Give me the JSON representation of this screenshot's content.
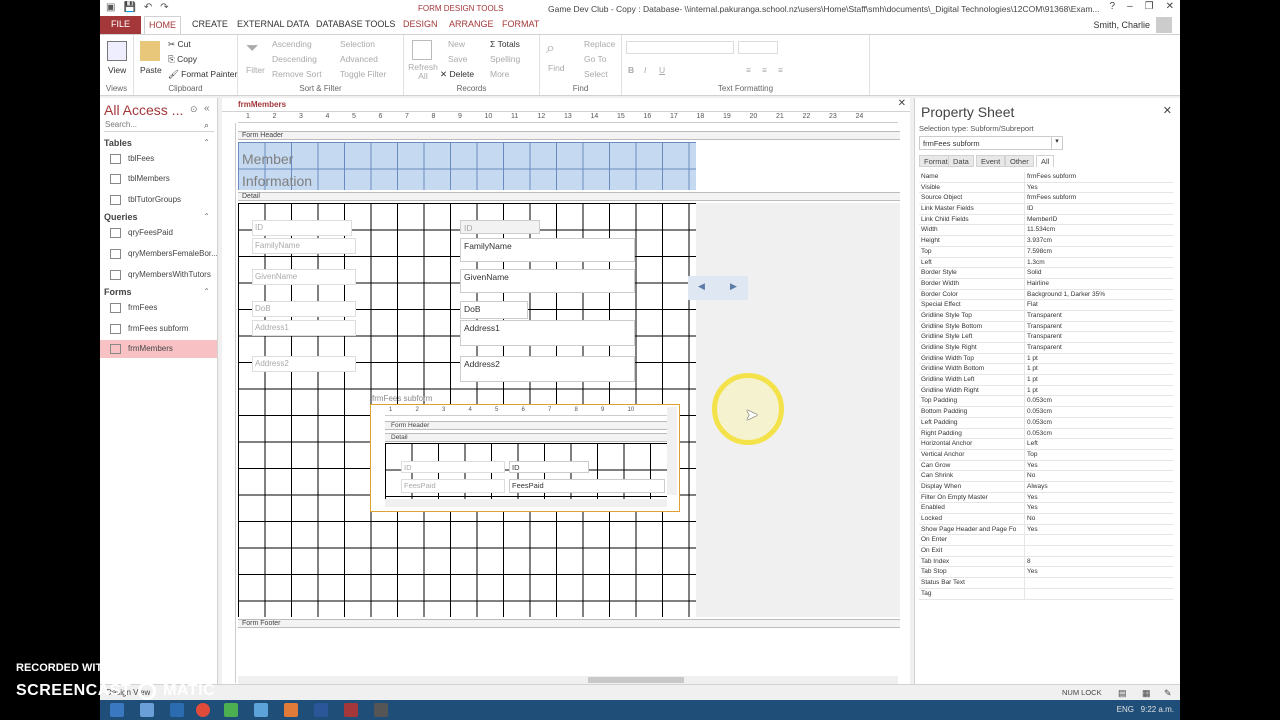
{
  "window": {
    "tools_label": "FORM DESIGN TOOLS",
    "title": "Game Dev Club - Copy : Database- \\\\internal.pakuranga.school.nz\\users\\Home\\Staff\\smh\\documents\\_Digital Technologies\\12COM\\91368\\Exam...",
    "user": "Smith, Charlie",
    "buttons": [
      "?",
      "–",
      "❐",
      "✕"
    ]
  },
  "tabs": [
    {
      "label": "FILE",
      "kind": "file"
    },
    {
      "label": "HOME",
      "kind": "active"
    },
    {
      "label": "CREATE",
      "kind": "normal"
    },
    {
      "label": "EXTERNAL DATA",
      "kind": "normal"
    },
    {
      "label": "DATABASE TOOLS",
      "kind": "normal"
    },
    {
      "label": "DESIGN",
      "kind": "ctx"
    },
    {
      "label": "ARRANGE",
      "kind": "ctx"
    },
    {
      "label": "FORMAT",
      "kind": "ctx"
    }
  ],
  "ribbon": {
    "views": {
      "label": "Views",
      "view": "View"
    },
    "clipboard": {
      "label": "Clipboard",
      "paste": "Paste",
      "cut": "Cut",
      "copy": "Copy",
      "format_painter": "Format Painter"
    },
    "sortfilter": {
      "label": "Sort & Filter",
      "filter": "Filter",
      "ascending": "Ascending",
      "descending": "Descending",
      "remove_sort": "Remove Sort",
      "selection": "Selection",
      "advanced": "Advanced",
      "toggle_filter": "Toggle Filter"
    },
    "records": {
      "label": "Records",
      "refresh": "Refresh All",
      "new": "New",
      "save": "Save",
      "delete": "Delete",
      "totals": "Totals",
      "spelling": "Spelling",
      "more": "More"
    },
    "find": {
      "label": "Find",
      "find": "Find",
      "replace": "Replace",
      "goto": "Go To",
      "select": "Select"
    },
    "textformatting": {
      "label": "Text Formatting",
      "bold": "B",
      "italic": "I",
      "underline": "U"
    }
  },
  "nav": {
    "title": "All Access ...",
    "search_placeholder": "Search...",
    "tables_label": "Tables",
    "tables": [
      "tblFees",
      "tblMembers",
      "tblTutorGroups"
    ],
    "queries_label": "Queries",
    "queries": [
      "qryFeesPaid",
      "qryMembersFemaleBor...",
      "qryMembersWithTutors"
    ],
    "forms_label": "Forms",
    "forms": [
      "frmFees",
      "frmFees subform",
      "frmMembers"
    ]
  },
  "document": {
    "tab": "frmMembers",
    "ruler": [
      "1",
      "2",
      "3",
      "4",
      "5",
      "6",
      "7",
      "8",
      "9",
      "10",
      "11",
      "12",
      "13",
      "14",
      "15",
      "16",
      "17",
      "18",
      "19",
      "20",
      "21",
      "22",
      "23",
      "24"
    ],
    "band_header": "Form Header",
    "band_detail": "Detail",
    "band_footer": "Form Footer",
    "form_title": "Member Information",
    "fields": [
      {
        "label": "ID",
        "control": "ID"
      },
      {
        "label": "FamilyName",
        "control": "FamilyName"
      },
      {
        "label": "GivenName",
        "control": "GivenName"
      },
      {
        "label": "DoB",
        "control": "DoB"
      },
      {
        "label": "Address1",
        "control": "Address1"
      },
      {
        "label": "Address2",
        "control": "Address2"
      }
    ],
    "subform": {
      "label": "frmFees subform",
      "ruler": [
        "1",
        "2",
        "3",
        "4",
        "5",
        "6",
        "7",
        "8",
        "9",
        "10"
      ],
      "band_header": "Form Header",
      "band_detail": "Detail",
      "fields": [
        {
          "label": "ID",
          "control": "ID"
        },
        {
          "label": "FeesPaid",
          "control": "FeesPaid"
        }
      ]
    }
  },
  "property_sheet": {
    "title": "Property Sheet",
    "selection_type": "Selection type:  Subform/Subreport",
    "selected_object": "frmFees subform",
    "tabs": [
      "Format",
      "Data",
      "Event",
      "Other",
      "All"
    ],
    "active_tab": "All",
    "rows": [
      [
        "Name",
        "frmFees subform"
      ],
      [
        "Visible",
        "Yes"
      ],
      [
        "Source Object",
        "frmFees subform"
      ],
      [
        "Link Master Fields",
        "ID"
      ],
      [
        "Link Child Fields",
        "MemberID"
      ],
      [
        "Width",
        "11.534cm"
      ],
      [
        "Height",
        "3.937cm"
      ],
      [
        "Top",
        "7.598cm"
      ],
      [
        "Left",
        "1.3cm"
      ],
      [
        "Border Style",
        "Solid"
      ],
      [
        "Border Width",
        "Hairline"
      ],
      [
        "Border Color",
        "Background 1, Darker 35%"
      ],
      [
        "Special Effect",
        "Flat"
      ],
      [
        "Gridline Style Top",
        "Transparent"
      ],
      [
        "Gridline Style Bottom",
        "Transparent"
      ],
      [
        "Gridline Style Left",
        "Transparent"
      ],
      [
        "Gridline Style Right",
        "Transparent"
      ],
      [
        "Gridline Width Top",
        "1 pt"
      ],
      [
        "Gridline Width Bottom",
        "1 pt"
      ],
      [
        "Gridline Width Left",
        "1 pt"
      ],
      [
        "Gridline Width Right",
        "1 pt"
      ],
      [
        "Top Padding",
        "0.053cm"
      ],
      [
        "Bottom Padding",
        "0.053cm"
      ],
      [
        "Left Padding",
        "0.053cm"
      ],
      [
        "Right Padding",
        "0.053cm"
      ],
      [
        "Horizontal Anchor",
        "Left"
      ],
      [
        "Vertical Anchor",
        "Top"
      ],
      [
        "Can Grow",
        "Yes"
      ],
      [
        "Can Shrink",
        "No"
      ],
      [
        "Display When",
        "Always"
      ],
      [
        "Filter On Empty Master",
        "Yes"
      ],
      [
        "Enabled",
        "Yes"
      ],
      [
        "Locked",
        "No"
      ],
      [
        "Show Page Header and Page Fo",
        "Yes"
      ],
      [
        "On Enter",
        ""
      ],
      [
        "On Exit",
        ""
      ],
      [
        "Tab Index",
        "8"
      ],
      [
        "Tab Stop",
        "Yes"
      ],
      [
        "Status Bar Text",
        ""
      ],
      [
        "Tag",
        ""
      ]
    ]
  },
  "status": {
    "left": "Design View",
    "numlock": "NUM LOCK"
  },
  "taskbar": {
    "lang": "ENG",
    "time": "9:22 a.m."
  },
  "watermark": {
    "line1": "RECORDED WITH",
    "line2": "SCREENCAST",
    "line3": "MATIC"
  },
  "colors": {
    "accent": "#a4373a",
    "selected_nav": "#f8c2c4",
    "header_band": "#c5d9f1",
    "taskbar": "#1f4e79"
  }
}
